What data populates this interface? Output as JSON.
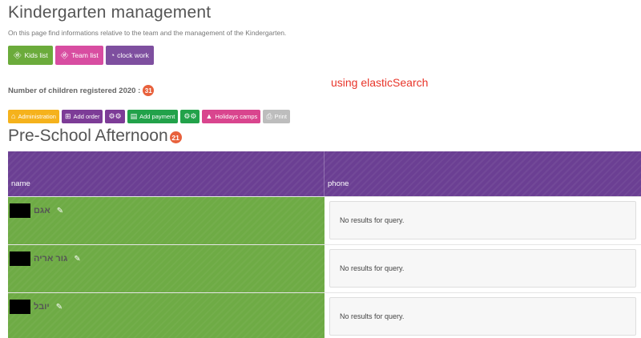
{
  "header": {
    "title": "Kindergarten management",
    "subtitle": "On this page find informations relative to the team and the management of the Kindergarten."
  },
  "top_buttons": [
    {
      "label": "Kids list",
      "icon": "child-icon",
      "color": "#6bab3b"
    },
    {
      "label": "Team list",
      "icon": "child-icon",
      "color": "#d84da1"
    },
    {
      "label": "clock work",
      "icon": "clock-icon",
      "color": "#7e4f9f"
    }
  ],
  "children_count": {
    "label": "Number of children registered 2020 :",
    "value": "31"
  },
  "note": "using elasticSearch",
  "action_buttons": [
    {
      "label": "Administration",
      "icon": "bank-icon",
      "color": "#f5b21c"
    },
    {
      "label": "Add order",
      "icon": "plus-square-icon",
      "color": "#7d3c97"
    },
    {
      "label": "",
      "icon": "gears-icon",
      "color": "#7d3c97"
    },
    {
      "label": "Add payment",
      "icon": "money-icon",
      "color": "#22a24a"
    },
    {
      "label": "",
      "icon": "gears-icon",
      "color": "#22a24a"
    },
    {
      "label": "Holidays camps",
      "icon": "tent-icon",
      "color": "#d9458e"
    },
    {
      "label": "Print",
      "icon": "print-icon",
      "color": "#bdbdbd"
    }
  ],
  "section": {
    "title": "Pre-School Afternoon",
    "count": "21"
  },
  "table": {
    "headers": {
      "name": "name",
      "phone": "phone"
    },
    "rows": [
      {
        "name": "אגם",
        "phone": "No results for query."
      },
      {
        "name": "גור אריה",
        "phone": "No results for query."
      },
      {
        "name": "יובל",
        "phone": "No results for query."
      }
    ]
  }
}
